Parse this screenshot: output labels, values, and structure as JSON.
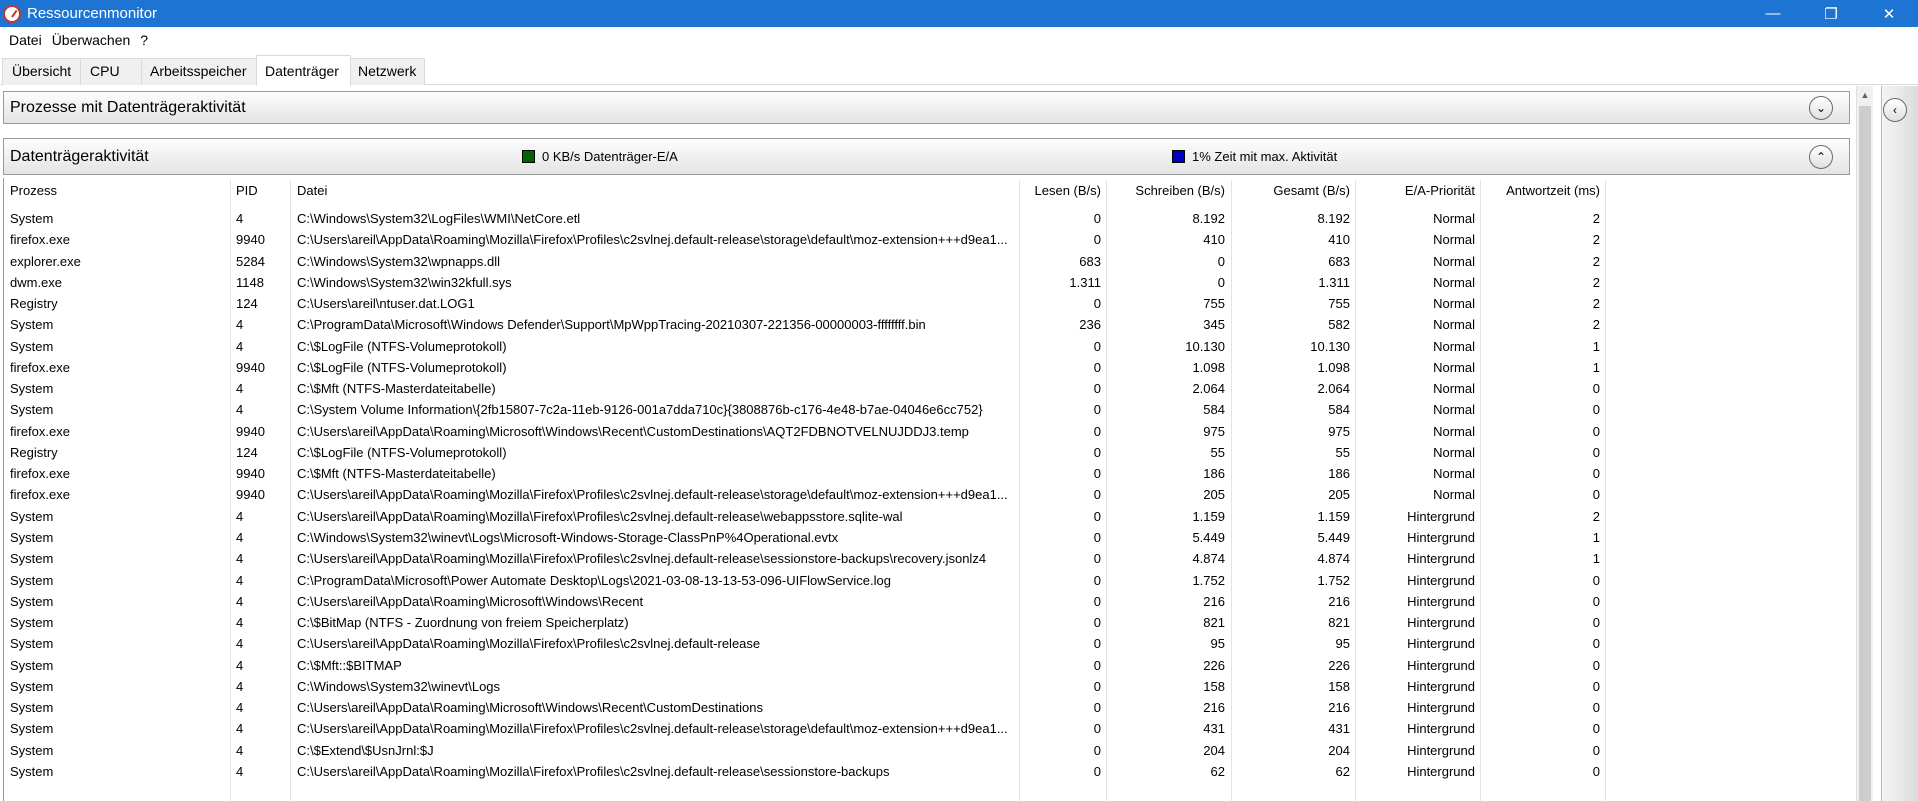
{
  "window": {
    "title": "Ressourcenmonitor",
    "minimize_glyph": "—",
    "restore_glyph": "❐",
    "close_glyph": "✕"
  },
  "menu": {
    "datei": "Datei",
    "ueberwachen": "Überwachen",
    "hilfe": "?"
  },
  "tabs": {
    "uebersicht": "Übersicht",
    "cpu": "CPU",
    "arbeitsspeicher": "Arbeitsspeicher",
    "datentraeger": "Datenträger",
    "netzwerk": "Netzwerk",
    "active": "Datenträger"
  },
  "sections": {
    "processes": {
      "title": "Prozesse mit Datenträgeraktivität",
      "state": "collapsed"
    },
    "activity": {
      "title": "Datenträgeraktivität",
      "state": "expanded",
      "legend_io": "0 KB/s Datenträger-E/A",
      "legend_io_color": "#006400",
      "legend_time": "1% Zeit mit max. Aktivität",
      "legend_time_color": "#0000c0"
    }
  },
  "icons": {
    "toggle_collapsed": "chevron-down-icon",
    "toggle_expanded": "chevron-up-icon",
    "side_panel": "chevron-left-icon",
    "glyph_down": "⌄",
    "glyph_up": "⌃",
    "glyph_left": "‹",
    "scroll_up": "▲"
  },
  "table": {
    "columns": {
      "process": "Prozess",
      "pid": "PID",
      "file": "Datei",
      "read": "Lesen (B/s)",
      "write": "Schreiben (B/s)",
      "total": "Gesamt (B/s)",
      "priority": "E/A-Priorität",
      "response": "Antwortzeit (ms)"
    },
    "rows": [
      [
        "System",
        "4",
        "C:\\Windows\\System32\\LogFiles\\WMI\\NetCore.etl",
        "0",
        "8.192",
        "8.192",
        "Normal",
        "2"
      ],
      [
        "firefox.exe",
        "9940",
        "C:\\Users\\areil\\AppData\\Roaming\\Mozilla\\Firefox\\Profiles\\c2svlnej.default-release\\storage\\default\\moz-extension+++d9ea1...",
        "0",
        "410",
        "410",
        "Normal",
        "2"
      ],
      [
        "explorer.exe",
        "5284",
        "C:\\Windows\\System32\\wpnapps.dll",
        "683",
        "0",
        "683",
        "Normal",
        "2"
      ],
      [
        "dwm.exe",
        "1148",
        "C:\\Windows\\System32\\win32kfull.sys",
        "1.311",
        "0",
        "1.311",
        "Normal",
        "2"
      ],
      [
        "Registry",
        "124",
        "C:\\Users\\areil\\ntuser.dat.LOG1",
        "0",
        "755",
        "755",
        "Normal",
        "2"
      ],
      [
        "System",
        "4",
        "C:\\ProgramData\\Microsoft\\Windows Defender\\Support\\MpWppTracing-20210307-221356-00000003-ffffffff.bin",
        "236",
        "345",
        "582",
        "Normal",
        "2"
      ],
      [
        "System",
        "4",
        "C:\\$LogFile (NTFS-Volumeprotokoll)",
        "0",
        "10.130",
        "10.130",
        "Normal",
        "1"
      ],
      [
        "firefox.exe",
        "9940",
        "C:\\$LogFile (NTFS-Volumeprotokoll)",
        "0",
        "1.098",
        "1.098",
        "Normal",
        "1"
      ],
      [
        "System",
        "4",
        "C:\\$Mft (NTFS-Masterdateitabelle)",
        "0",
        "2.064",
        "2.064",
        "Normal",
        "0"
      ],
      [
        "System",
        "4",
        "C:\\System Volume Information\\{2fb15807-7c2a-11eb-9126-001a7dda710c}{3808876b-c176-4e48-b7ae-04046e6cc752}",
        "0",
        "584",
        "584",
        "Normal",
        "0"
      ],
      [
        "firefox.exe",
        "9940",
        "C:\\Users\\areil\\AppData\\Roaming\\Microsoft\\Windows\\Recent\\CustomDestinations\\AQT2FDBNOTVELNUJDDJ3.temp",
        "0",
        "975",
        "975",
        "Normal",
        "0"
      ],
      [
        "Registry",
        "124",
        "C:\\$LogFile (NTFS-Volumeprotokoll)",
        "0",
        "55",
        "55",
        "Normal",
        "0"
      ],
      [
        "firefox.exe",
        "9940",
        "C:\\$Mft (NTFS-Masterdateitabelle)",
        "0",
        "186",
        "186",
        "Normal",
        "0"
      ],
      [
        "firefox.exe",
        "9940",
        "C:\\Users\\areil\\AppData\\Roaming\\Mozilla\\Firefox\\Profiles\\c2svlnej.default-release\\storage\\default\\moz-extension+++d9ea1...",
        "0",
        "205",
        "205",
        "Normal",
        "0"
      ],
      [
        "System",
        "4",
        "C:\\Users\\areil\\AppData\\Roaming\\Mozilla\\Firefox\\Profiles\\c2svlnej.default-release\\webappsstore.sqlite-wal",
        "0",
        "1.159",
        "1.159",
        "Hintergrund",
        "2"
      ],
      [
        "System",
        "4",
        "C:\\Windows\\System32\\winevt\\Logs\\Microsoft-Windows-Storage-ClassPnP%4Operational.evtx",
        "0",
        "5.449",
        "5.449",
        "Hintergrund",
        "1"
      ],
      [
        "System",
        "4",
        "C:\\Users\\areil\\AppData\\Roaming\\Mozilla\\Firefox\\Profiles\\c2svlnej.default-release\\sessionstore-backups\\recovery.jsonlz4",
        "0",
        "4.874",
        "4.874",
        "Hintergrund",
        "1"
      ],
      [
        "System",
        "4",
        "C:\\ProgramData\\Microsoft\\Power Automate Desktop\\Logs\\2021-03-08-13-13-53-096-UIFlowService.log",
        "0",
        "1.752",
        "1.752",
        "Hintergrund",
        "0"
      ],
      [
        "System",
        "4",
        "C:\\Users\\areil\\AppData\\Roaming\\Microsoft\\Windows\\Recent",
        "0",
        "216",
        "216",
        "Hintergrund",
        "0"
      ],
      [
        "System",
        "4",
        "C:\\$BitMap (NTFS - Zuordnung von freiem Speicherplatz)",
        "0",
        "821",
        "821",
        "Hintergrund",
        "0"
      ],
      [
        "System",
        "4",
        "C:\\Users\\areil\\AppData\\Roaming\\Mozilla\\Firefox\\Profiles\\c2svlnej.default-release",
        "0",
        "95",
        "95",
        "Hintergrund",
        "0"
      ],
      [
        "System",
        "4",
        "C:\\$Mft::$BITMAP",
        "0",
        "226",
        "226",
        "Hintergrund",
        "0"
      ],
      [
        "System",
        "4",
        "C:\\Windows\\System32\\winevt\\Logs",
        "0",
        "158",
        "158",
        "Hintergrund",
        "0"
      ],
      [
        "System",
        "4",
        "C:\\Users\\areil\\AppData\\Roaming\\Microsoft\\Windows\\Recent\\CustomDestinations",
        "0",
        "216",
        "216",
        "Hintergrund",
        "0"
      ],
      [
        "System",
        "4",
        "C:\\Users\\areil\\AppData\\Roaming\\Mozilla\\Firefox\\Profiles\\c2svlnej.default-release\\storage\\default\\moz-extension+++d9ea1...",
        "0",
        "431",
        "431",
        "Hintergrund",
        "0"
      ],
      [
        "System",
        "4",
        "C:\\$Extend\\$UsnJrnl:$J",
        "0",
        "204",
        "204",
        "Hintergrund",
        "0"
      ],
      [
        "System",
        "4",
        "C:\\Users\\areil\\AppData\\Roaming\\Mozilla\\Firefox\\Profiles\\c2svlnej.default-release\\sessionstore-backups",
        "0",
        "62",
        "62",
        "Hintergrund",
        "0"
      ]
    ]
  }
}
